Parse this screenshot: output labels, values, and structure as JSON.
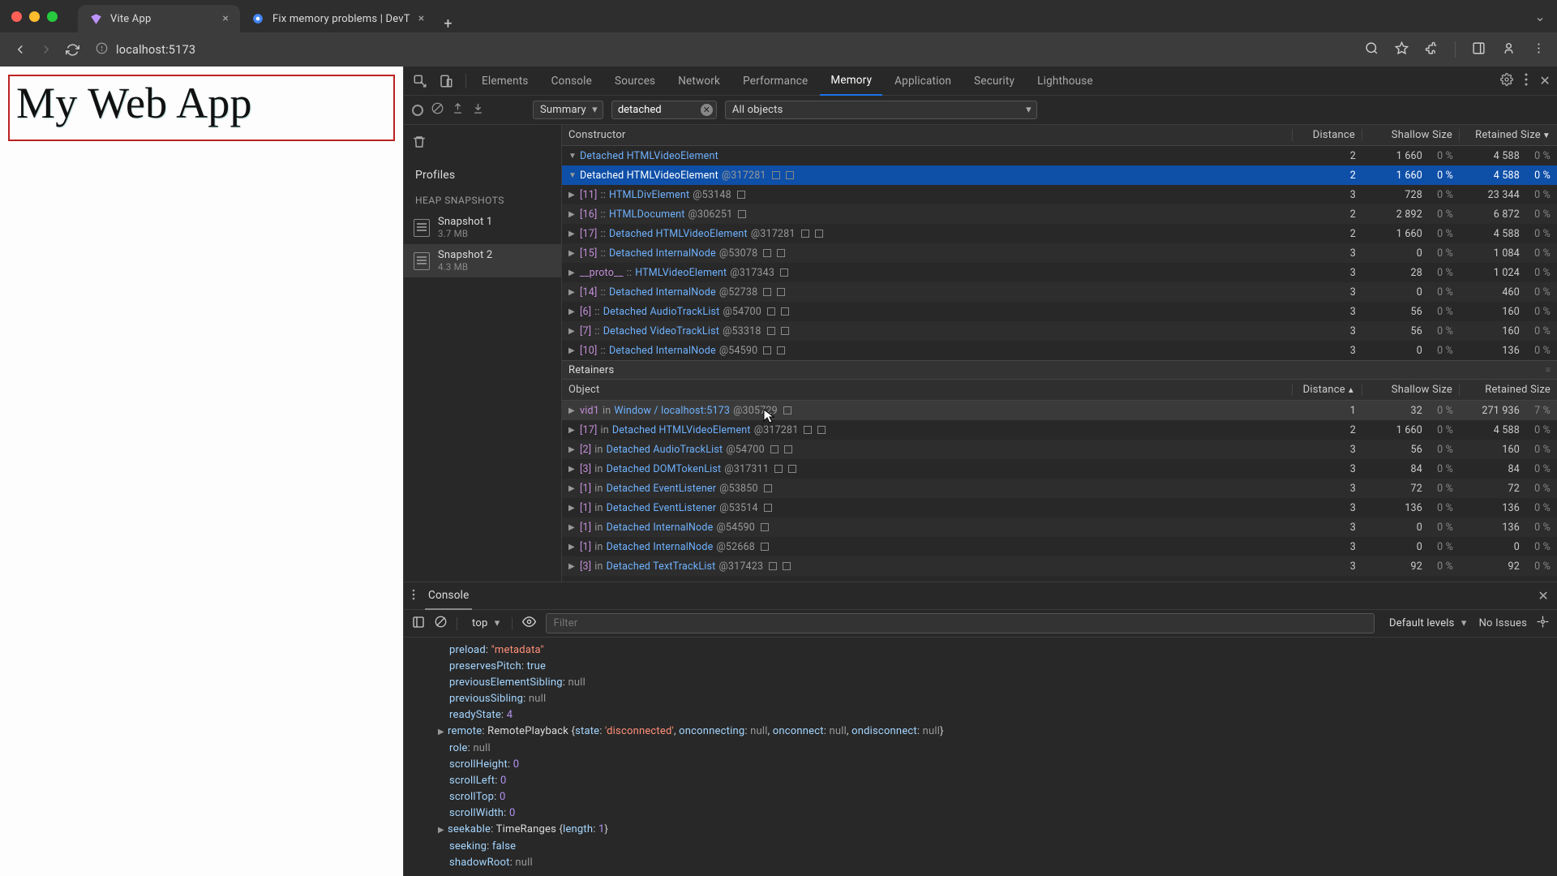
{
  "browser": {
    "tabs": [
      {
        "title": "Vite App",
        "active": true,
        "favicon": "V"
      },
      {
        "title": "Fix memory problems | DevT",
        "active": false,
        "favicon": "chrome"
      }
    ],
    "address": "localhost:5173"
  },
  "page": {
    "heading": "My Web App"
  },
  "devtools": {
    "tabs": [
      "Elements",
      "Console",
      "Sources",
      "Network",
      "Performance",
      "Memory",
      "Application",
      "Security",
      "Lighthouse"
    ],
    "active_tab": "Memory",
    "summary_label": "Summary",
    "filter_value": "detached",
    "scope_label": "All objects",
    "sidebar": {
      "profiles_label": "Profiles",
      "snapshots_label": "HEAP SNAPSHOTS",
      "snapshots": [
        {
          "name": "Snapshot 1",
          "size": "3.7 MB",
          "selected": false
        },
        {
          "name": "Snapshot 2",
          "size": "4.3 MB",
          "selected": true
        }
      ]
    },
    "constructors_header": {
      "c0": "Constructor",
      "c1": "Distance",
      "c2": "Shallow Size",
      "c3": "Retained Size"
    },
    "constructors": [
      {
        "indent": 0,
        "tri": "▼",
        "text": "Detached HTMLVideoElement",
        "dist": "2",
        "sh": "1 660",
        "shp": "0 %",
        "ret": "4 588",
        "retp": "0 %",
        "sel": false
      },
      {
        "indent": 1,
        "tri": "▼",
        "text": "Detached HTMLVideoElement",
        "id": "@317281",
        "badges": 2,
        "dist": "2",
        "sh": "1 660",
        "shp": "0 %",
        "ret": "4 588",
        "retp": "0 %",
        "sel": true
      },
      {
        "indent": 2,
        "tri": "▶",
        "idx": "[11]",
        "sep": "::",
        "text": "HTMLDivElement",
        "id": "@53148",
        "badges": 1,
        "dist": "3",
        "sh": "728",
        "shp": "0 %",
        "ret": "23 344",
        "retp": "0 %"
      },
      {
        "indent": 2,
        "tri": "▶",
        "idx": "[16]",
        "sep": "::",
        "text": "HTMLDocument",
        "id": "@306251",
        "badges": 1,
        "dist": "2",
        "sh": "2 892",
        "shp": "0 %",
        "ret": "6 872",
        "retp": "0 %"
      },
      {
        "indent": 2,
        "tri": "▶",
        "idx": "[17]",
        "sep": "::",
        "text": "Detached HTMLVideoElement",
        "id": "@317281",
        "badges": 2,
        "dist": "2",
        "sh": "1 660",
        "shp": "0 %",
        "ret": "4 588",
        "retp": "0 %"
      },
      {
        "indent": 2,
        "tri": "▶",
        "idx": "[15]",
        "sep": "::",
        "text": "Detached InternalNode",
        "id": "@53078",
        "badges": 2,
        "dist": "3",
        "sh": "0",
        "shp": "0 %",
        "ret": "1 084",
        "retp": "0 %"
      },
      {
        "indent": 2,
        "tri": "▶",
        "proto": "__proto__",
        "sep": "::",
        "text": "HTMLVideoElement",
        "id": "@317343",
        "badges": 1,
        "dist": "3",
        "sh": "28",
        "shp": "0 %",
        "ret": "1 024",
        "retp": "0 %"
      },
      {
        "indent": 2,
        "tri": "▶",
        "idx": "[14]",
        "sep": "::",
        "text": "Detached InternalNode",
        "id": "@52738",
        "badges": 2,
        "dist": "3",
        "sh": "0",
        "shp": "0 %",
        "ret": "460",
        "retp": "0 %"
      },
      {
        "indent": 2,
        "tri": "▶",
        "idx": "[6]",
        "sep": "::",
        "text": "Detached AudioTrackList",
        "id": "@54700",
        "badges": 2,
        "dist": "3",
        "sh": "56",
        "shp": "0 %",
        "ret": "160",
        "retp": "0 %"
      },
      {
        "indent": 2,
        "tri": "▶",
        "idx": "[7]",
        "sep": "::",
        "text": "Detached VideoTrackList",
        "id": "@53318",
        "badges": 2,
        "dist": "3",
        "sh": "56",
        "shp": "0 %",
        "ret": "160",
        "retp": "0 %"
      },
      {
        "indent": 2,
        "tri": "▶",
        "idx": "[10]",
        "sep": "::",
        "text": "Detached InternalNode",
        "id": "@54590",
        "badges": 2,
        "dist": "3",
        "sh": "0",
        "shp": "0 %",
        "ret": "136",
        "retp": "0 %"
      }
    ],
    "retainers_label": "Retainers",
    "retainers_header": {
      "c0": "Object",
      "c1": "Distance",
      "c2": "Shallow Size",
      "c3": "Retained Size"
    },
    "retainers": [
      {
        "tri": "▶",
        "idx": "vid1",
        "in": "in",
        "text": "Window / localhost:5173",
        "id": "@305729",
        "badges": 1,
        "dist": "1",
        "sh": "32",
        "shp": "0 %",
        "ret": "271 936",
        "retp": "7 %",
        "hl": true
      },
      {
        "tri": "▶",
        "idx": "[17]",
        "in": "in",
        "text": "Detached HTMLVideoElement",
        "id": "@317281",
        "badges": 2,
        "dist": "2",
        "sh": "1 660",
        "shp": "0 %",
        "ret": "4 588",
        "retp": "0 %"
      },
      {
        "tri": "▶",
        "idx": "[2]",
        "in": "in",
        "text": "Detached AudioTrackList",
        "id": "@54700",
        "badges": 2,
        "dist": "3",
        "sh": "56",
        "shp": "0 %",
        "ret": "160",
        "retp": "0 %"
      },
      {
        "tri": "▶",
        "idx": "[3]",
        "in": "in",
        "text": "Detached DOMTokenList",
        "id": "@317311",
        "badges": 2,
        "dist": "3",
        "sh": "84",
        "shp": "0 %",
        "ret": "84",
        "retp": "0 %"
      },
      {
        "tri": "▶",
        "idx": "[1]",
        "in": "in",
        "text": "Detached EventListener",
        "id": "@53850",
        "badges": 1,
        "dist": "3",
        "sh": "72",
        "shp": "0 %",
        "ret": "72",
        "retp": "0 %"
      },
      {
        "tri": "▶",
        "idx": "[1]",
        "in": "in",
        "text": "Detached EventListener",
        "id": "@53514",
        "badges": 1,
        "dist": "3",
        "sh": "136",
        "shp": "0 %",
        "ret": "136",
        "retp": "0 %"
      },
      {
        "tri": "▶",
        "idx": "[1]",
        "in": "in",
        "text": "Detached InternalNode",
        "id": "@54590",
        "badges": 1,
        "dist": "3",
        "sh": "0",
        "shp": "0 %",
        "ret": "136",
        "retp": "0 %"
      },
      {
        "tri": "▶",
        "idx": "[1]",
        "in": "in",
        "text": "Detached InternalNode",
        "id": "@52668",
        "badges": 1,
        "dist": "3",
        "sh": "0",
        "shp": "0 %",
        "ret": "0",
        "retp": "0 %"
      },
      {
        "tri": "▶",
        "idx": "[3]",
        "in": "in",
        "text": "Detached TextTrackList",
        "id": "@317423",
        "badges": 2,
        "dist": "3",
        "sh": "92",
        "shp": "0 %",
        "ret": "92",
        "retp": "0 %"
      }
    ],
    "console_drawer": {
      "tab": "Console",
      "context": "top",
      "filter_placeholder": "Filter",
      "levels": "Default levels",
      "issues": "No Issues",
      "lines": [
        {
          "type": "prop",
          "k": "preload",
          "v_str": "\"metadata\""
        },
        {
          "type": "prop",
          "k": "preservesPitch",
          "v_bool": "true"
        },
        {
          "type": "prop",
          "k": "previousElementSibling",
          "v_null": "null"
        },
        {
          "type": "prop",
          "k": "previousSibling",
          "v_null": "null"
        },
        {
          "type": "prop",
          "k": "readyState",
          "v_num": "4"
        },
        {
          "type": "obj",
          "exp": true,
          "k": "remote",
          "cls": "RemotePlayback",
          "body": "{state: 'disconnected', onconnecting: null, onconnect: null, ondisconnect: null}"
        },
        {
          "type": "prop",
          "k": "role",
          "v_null": "null"
        },
        {
          "type": "prop",
          "k": "scrollHeight",
          "v_num": "0"
        },
        {
          "type": "prop",
          "k": "scrollLeft",
          "v_num": "0"
        },
        {
          "type": "prop",
          "k": "scrollTop",
          "v_num": "0"
        },
        {
          "type": "prop",
          "k": "scrollWidth",
          "v_num": "0"
        },
        {
          "type": "obj",
          "exp": true,
          "k": "seekable",
          "cls": "TimeRanges",
          "body": "{length: 1}"
        },
        {
          "type": "prop",
          "k": "seeking",
          "v_bool": "false"
        },
        {
          "type": "prop",
          "k": "shadowRoot",
          "v_null": "null"
        }
      ]
    }
  }
}
